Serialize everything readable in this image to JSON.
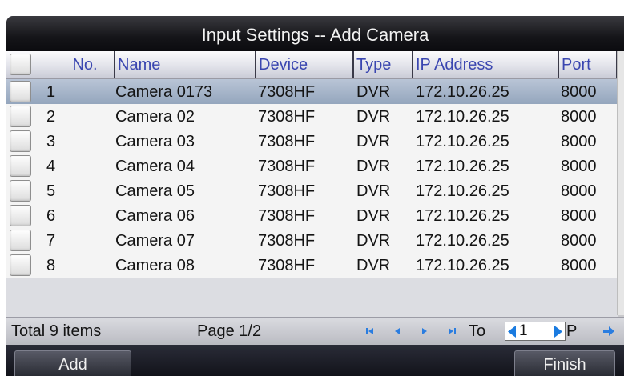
{
  "dialog": {
    "title": "Input Settings -- Add Camera"
  },
  "columns": {
    "no": "No.",
    "name": "Name",
    "device": "Device",
    "type": "Type",
    "ip": "IP Address",
    "port": "Port"
  },
  "rows": [
    {
      "no": "1",
      "name": "Camera 0173",
      "device": "7308HF",
      "type": "DVR",
      "ip": "172.10.26.25",
      "port": "8000"
    },
    {
      "no": "2",
      "name": "Camera 02",
      "device": "7308HF",
      "type": "DVR",
      "ip": "172.10.26.25",
      "port": "8000"
    },
    {
      "no": "3",
      "name": "Camera 03",
      "device": "7308HF",
      "type": "DVR",
      "ip": "172.10.26.25",
      "port": "8000"
    },
    {
      "no": "4",
      "name": "Camera 04",
      "device": "7308HF",
      "type": "DVR",
      "ip": "172.10.26.25",
      "port": "8000"
    },
    {
      "no": "5",
      "name": "Camera 05",
      "device": "7308HF",
      "type": "DVR",
      "ip": "172.10.26.25",
      "port": "8000"
    },
    {
      "no": "6",
      "name": "Camera 06",
      "device": "7308HF",
      "type": "DVR",
      "ip": "172.10.26.25",
      "port": "8000"
    },
    {
      "no": "7",
      "name": "Camera 07",
      "device": "7308HF",
      "type": "DVR",
      "ip": "172.10.26.25",
      "port": "8000"
    },
    {
      "no": "8",
      "name": "Camera 08",
      "device": "7308HF",
      "type": "DVR",
      "ip": "172.10.26.25",
      "port": "8000"
    }
  ],
  "selected_row": 0,
  "footer": {
    "total": "Total 9 items",
    "page": "Page 1/2",
    "to_label": "To",
    "page_input_value": "1",
    "page_suffix": "P"
  },
  "buttons": {
    "add": "Add",
    "finish": "Finish"
  },
  "icons": {
    "first_page": "first-page-icon",
    "prev_page": "prev-page-icon",
    "next_page": "next-page-icon",
    "last_page": "last-page-icon",
    "go": "go-arrow-icon",
    "decrement": "left-triangle-icon",
    "increment": "right-triangle-icon"
  },
  "colors": {
    "title_bar": "#151519",
    "header_text": "#3a46b0",
    "selected_row": "#9fb0c6",
    "accent_arrow": "#1a7be0"
  }
}
